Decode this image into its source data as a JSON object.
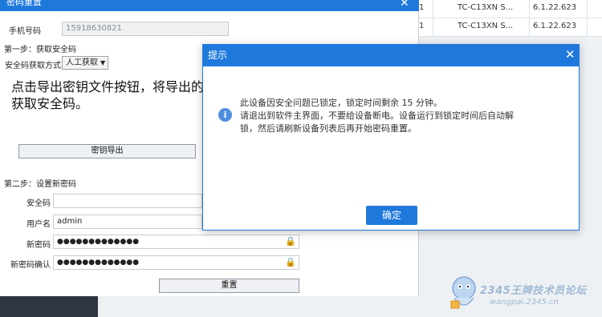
{
  "background": {
    "rows": [
      {
        "c1": "1",
        "c2": "TC-C13XN S...",
        "c3": "6.1.22.623"
      },
      {
        "c1": "1",
        "c2": "TC-C13XN S...",
        "c3": "6.1.22.623"
      }
    ]
  },
  "reset_dialog": {
    "title": "密码重置",
    "phone_label": "手机号码",
    "phone_value": "15918630821",
    "step1_title": "第一步：获取安全码",
    "method_label": "安全码获取方式",
    "method_value": "人工获取",
    "instruction_line1": "点击导出密钥文件按钮，将导出的da",
    "instruction_line2": "获取安全码。",
    "export_button": "密钥导出",
    "step2_title": "第二步：设置新密码",
    "security_code_label": "安全码",
    "security_code_value": "",
    "username_label": "用户名",
    "username_value": "admin",
    "new_password_label": "新密码",
    "new_password_value": "●●●●●●●●●●●●●",
    "confirm_password_label": "新密码确认",
    "confirm_password_value": "●●●●●●●●●●●●●",
    "reset_button": "重置"
  },
  "tip_modal": {
    "title": "提示",
    "line1": "此设备因安全问题已锁定，锁定时间剩余 15 分钟。",
    "line2": "请退出到软件主界面，不要给设备断电。设备运行到锁定时间后自动解",
    "line3": "锁，然后请刷新设备列表后再开始密码重置。",
    "ok_button": "确定"
  },
  "watermark": {
    "text": "2345王牌技术员论坛",
    "url": "wangpai.2345.cn"
  },
  "icons": {
    "close": "close-icon",
    "info": "info-icon",
    "lock": "lock-icon",
    "dropdown": "chevron-down-icon"
  },
  "colors": {
    "accent": "#1f79dc",
    "lock": "#e0a200"
  }
}
